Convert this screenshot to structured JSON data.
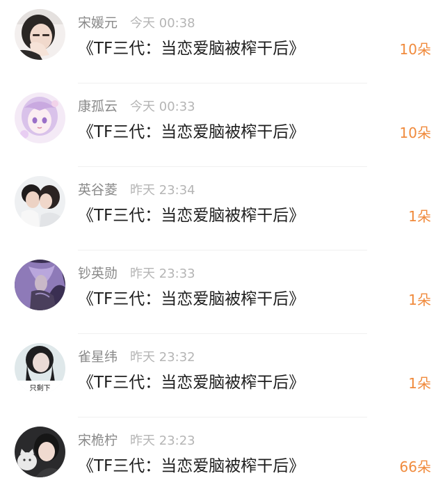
{
  "items": [
    {
      "username": "宋媛元",
      "time": "今天 00:38",
      "title": "《TF三代：当恋爱脑被榨干后》",
      "count": "10朵",
      "avatar": "avatar-girl-hand-over-face"
    },
    {
      "username": "康孤云",
      "time": "今天 00:33",
      "title": "《TF三代：当恋爱脑被榨干后》",
      "count": "10朵",
      "avatar": "avatar-anime-girl-purple"
    },
    {
      "username": "英谷菱",
      "time": "昨天 23:34",
      "title": "《TF三代：当恋爱脑被榨干后》",
      "count": "1朵",
      "avatar": "avatar-couple-kissing"
    },
    {
      "username": "钞英勋",
      "time": "昨天 23:33",
      "title": "《TF三代：当恋爱脑被榨干后》",
      "count": "1朵",
      "avatar": "avatar-purple-hair-character"
    },
    {
      "username": "雀星纬",
      "time": "昨天 23:32",
      "title": "《TF三代：当恋爱脑被榨干后》",
      "count": "1朵",
      "avatar": "avatar-girl-with-caption",
      "avatar_caption": "只剩下"
    },
    {
      "username": "宋桅柠",
      "time": "昨天 23:23",
      "title": "《TF三代：当恋爱脑被榨干后》",
      "count": "66朵",
      "avatar": "avatar-girl-with-cat"
    }
  ],
  "colors": {
    "username": "#8a8a8a",
    "time": "#b5b5b5",
    "title": "#1e1e1e",
    "count": "#f08a3c",
    "divider": "#f0f0f0"
  }
}
